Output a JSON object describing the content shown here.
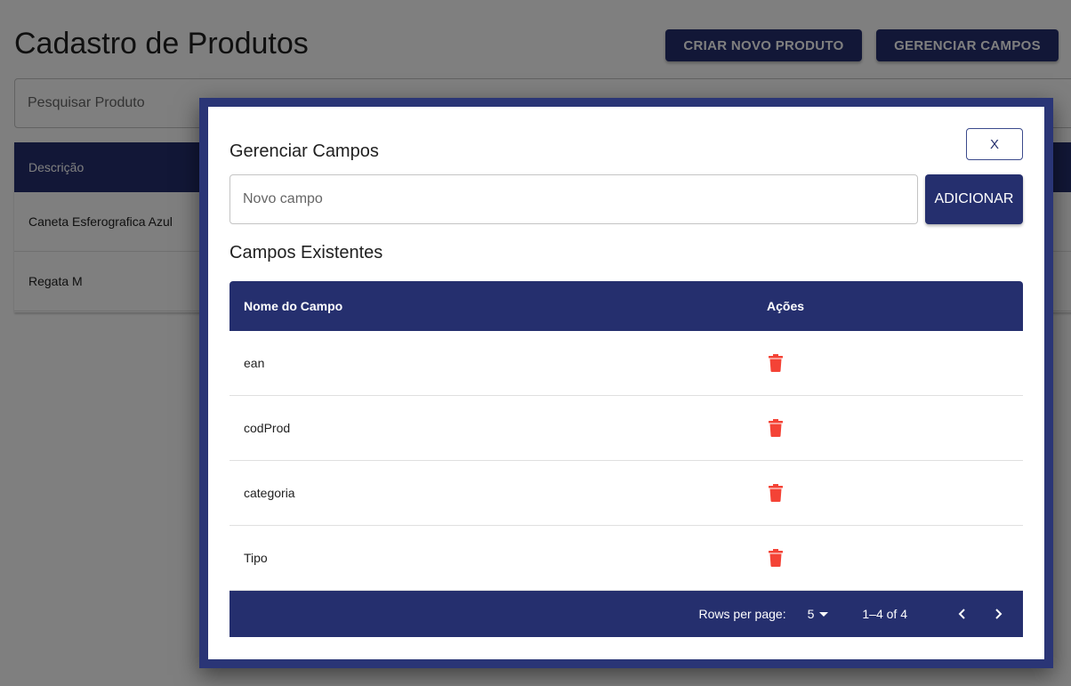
{
  "page": {
    "title": "Cadastro de Produtos",
    "create_button": "CRIAR NOVO PRODUTO",
    "manage_button": "GERENCIAR CAMPOS",
    "search_placeholder": "Pesquisar Produto",
    "table_header": "Descrição",
    "rows": [
      "Caneta Esferografica Azul",
      "Regata M"
    ]
  },
  "modal": {
    "title": "Gerenciar Campos",
    "close_label": "X",
    "new_field_placeholder": "Novo campo",
    "add_button": "ADICIONAR",
    "section_title": "Campos Existentes",
    "columns": [
      "Nome do Campo",
      "Ações"
    ],
    "fields": [
      "ean",
      "codProd",
      "categoria",
      "Tipo"
    ],
    "pagination": {
      "rows_per_page_label": "Rows per page:",
      "rows_per_page": "5",
      "range": "1–4 of 4"
    }
  },
  "colors": {
    "primary": "#252f6e",
    "delete": "#f44336"
  },
  "icons": {
    "delete": "trash-icon",
    "prev": "chevron-left-icon",
    "next": "chevron-right-icon",
    "select": "caret-down-icon"
  }
}
